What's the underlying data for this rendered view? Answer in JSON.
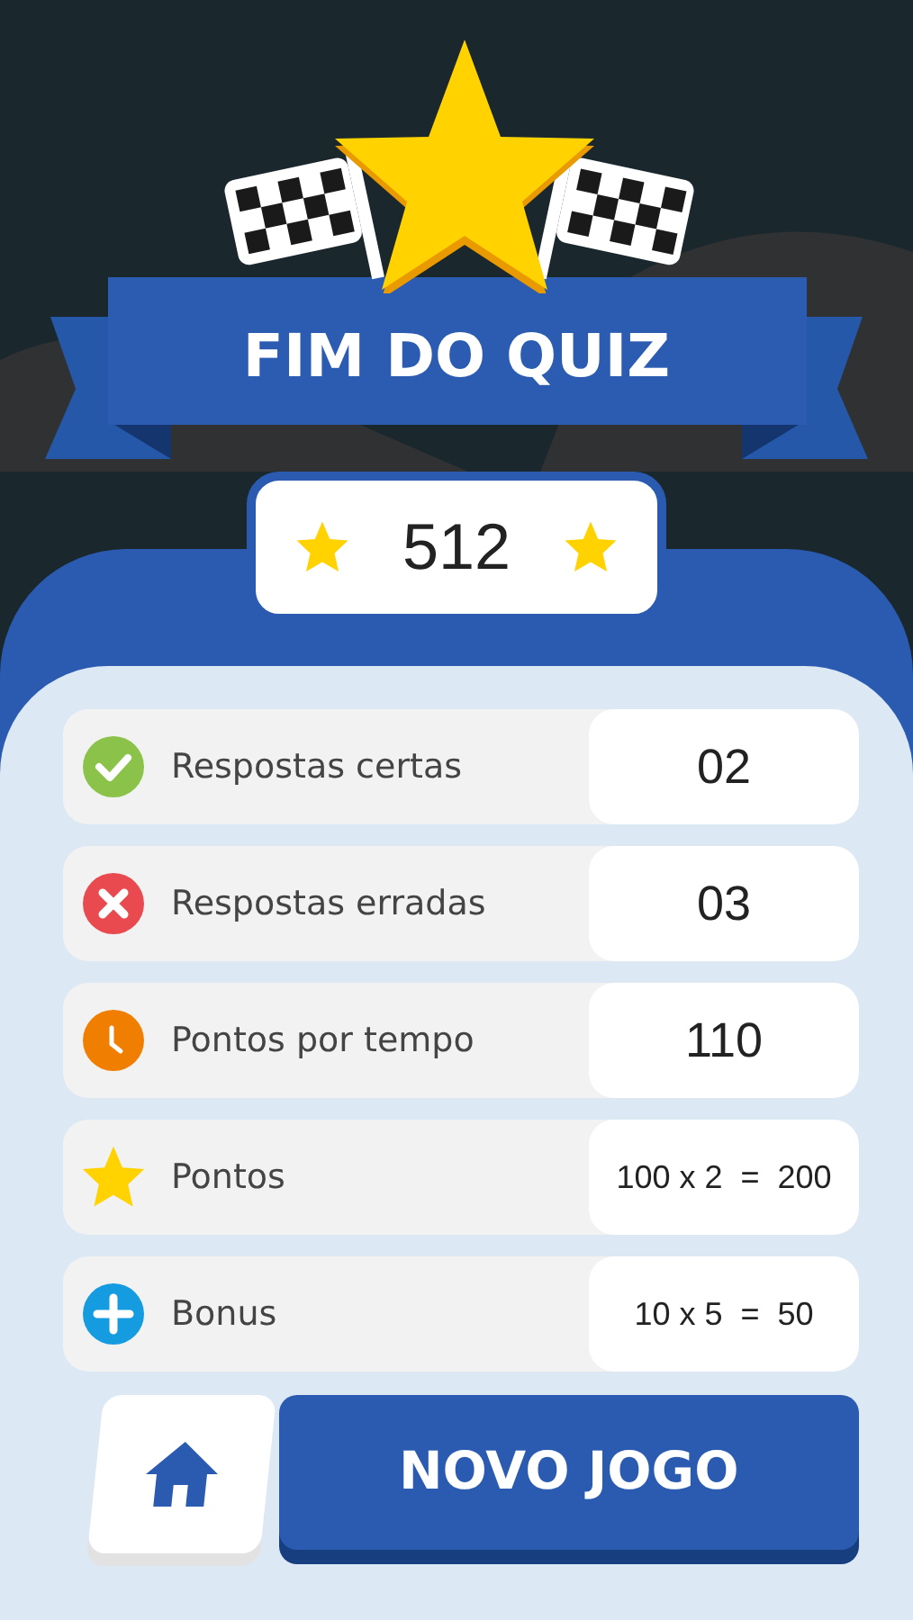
{
  "title": "FIM DO QUIZ",
  "score": "512",
  "stats": [
    {
      "kind": "correct",
      "label": "Respostas certas",
      "value": "02"
    },
    {
      "kind": "wrong",
      "label": "Respostas erradas",
      "value": "03"
    },
    {
      "kind": "time",
      "label": "Pontos por tempo",
      "value": "110"
    },
    {
      "kind": "points",
      "label": "Pontos",
      "value": "100 x 2  =  200"
    },
    {
      "kind": "bonus",
      "label": "Bonus",
      "value": "10 x 5  =  50"
    }
  ],
  "new_game_button": "NOVO JOGO"
}
